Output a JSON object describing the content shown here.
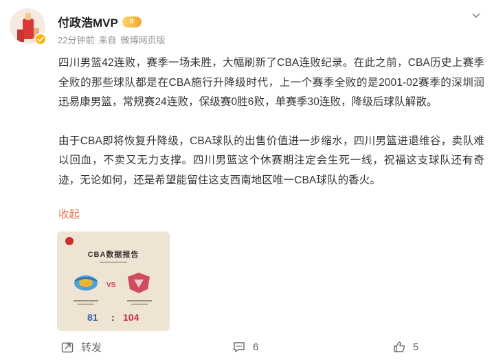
{
  "post": {
    "author": {
      "name": "付政浩MVP",
      "vip_level": "II"
    },
    "meta": {
      "time": "22分钟前",
      "source": "来自",
      "client": "微博网页版"
    },
    "paragraphs": [
      "四川男篮42连败，赛季一场未胜，大幅刷新了CBA连败纪录。在此之前，CBA历史上赛季全败的那些球队都是在CBA施行升降级时代，上一个赛季全败的是2001-02赛季的深圳润迅易康男篮，常规赛24连败，保级赛0胜6败，单赛季30连败，降级后球队解散。",
      "由于CBA即将恢复升降级，CBA球队的出售价值进一步缩水，四川男篮进退维谷，卖队难以回血，不卖又无力支撑。四川男篮这个休赛期注定会生死一线，祝福这支球队还有奇迹，无论如何，还是希望能留住这支西南地区唯一CBA球队的香火。"
    ],
    "collapse_label": "收起",
    "image": {
      "title": "CBA数据报告",
      "vs_label": "VS",
      "score_left": "81",
      "score_separator": ":",
      "score_right": "104"
    },
    "actions": {
      "repost_label": "转发",
      "comment_count": "6",
      "like_count": "5"
    }
  },
  "colors": {
    "accent": "#eb7350",
    "text": "#333333",
    "meta": "#939393",
    "badge": "#ffb400"
  }
}
